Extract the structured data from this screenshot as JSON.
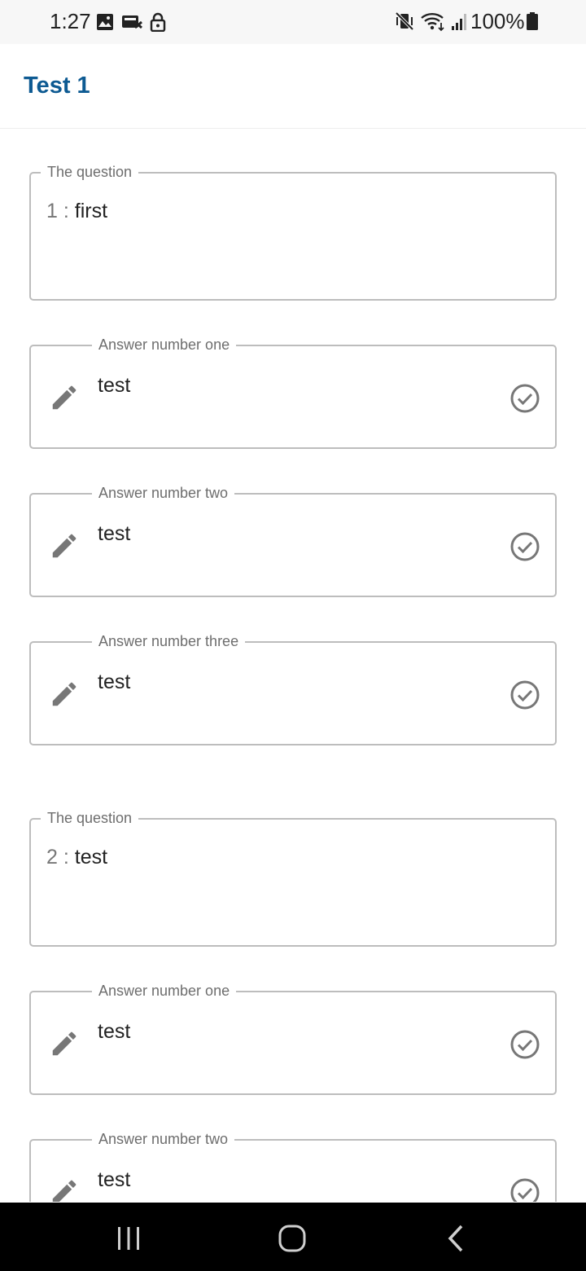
{
  "status_bar": {
    "time": "1:27",
    "left_icons": [
      "gallery-icon",
      "sync-icon",
      "lock-icon"
    ],
    "right_icons": [
      "vibrate-mute-icon",
      "wifi-icon",
      "signal-icon"
    ],
    "battery": "100%"
  },
  "header": {
    "title": "Test 1",
    "title_color": "#0d5a92"
  },
  "questions": [
    {
      "label": "The question",
      "number": "1 :",
      "text": "first",
      "answers": [
        {
          "label": "Answer number one",
          "value": "test"
        },
        {
          "label": "Answer number two",
          "value": "test"
        },
        {
          "label": "Answer number three",
          "value": "test"
        }
      ]
    },
    {
      "label": "The question",
      "number": "2 :",
      "text": "test",
      "answers": [
        {
          "label": "Answer number one",
          "value": "test"
        },
        {
          "label": "Answer number two",
          "value": "test"
        }
      ]
    }
  ],
  "icons": {
    "edit": "pencil-icon",
    "confirm": "check-circle-icon"
  },
  "nav_bar": {
    "buttons": [
      "recent-apps-icon",
      "home-icon",
      "back-icon"
    ]
  }
}
